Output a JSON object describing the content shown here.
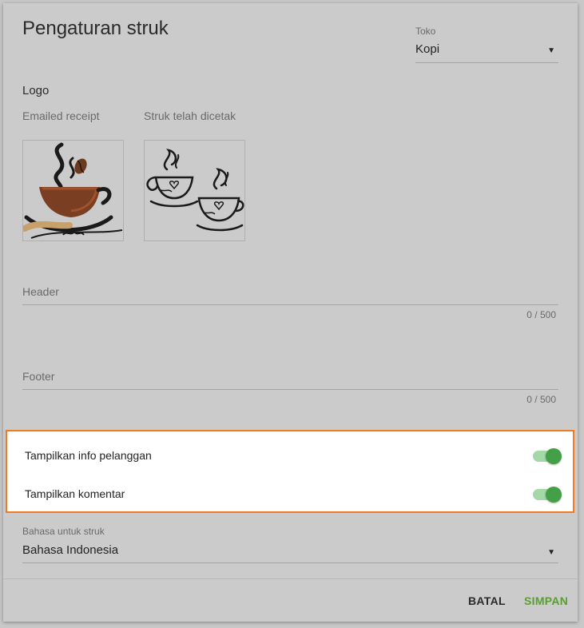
{
  "page": {
    "title": "Pengaturan struk"
  },
  "store": {
    "label": "Toko",
    "value": "Kopi"
  },
  "logo": {
    "label": "Logo",
    "emailed_label": "Emailed receipt",
    "printed_label": "Struk telah dicetak"
  },
  "header_field": {
    "placeholder": "Header",
    "counter": "0 / 500"
  },
  "footer_field": {
    "placeholder": "Footer",
    "counter": "0 / 500"
  },
  "toggles": [
    {
      "label": "Tampilkan info pelanggan",
      "on": true
    },
    {
      "label": "Tampilkan komentar",
      "on": true
    }
  ],
  "language": {
    "label": "Bahasa untuk struk",
    "value": "Bahasa Indonesia"
  },
  "actions": {
    "cancel_label": "BATAL",
    "save_label": "SIMPAN"
  },
  "colors": {
    "accent_green": "#43a047",
    "save_text": "#5a9e2f",
    "highlight_border": "#f07b24"
  }
}
